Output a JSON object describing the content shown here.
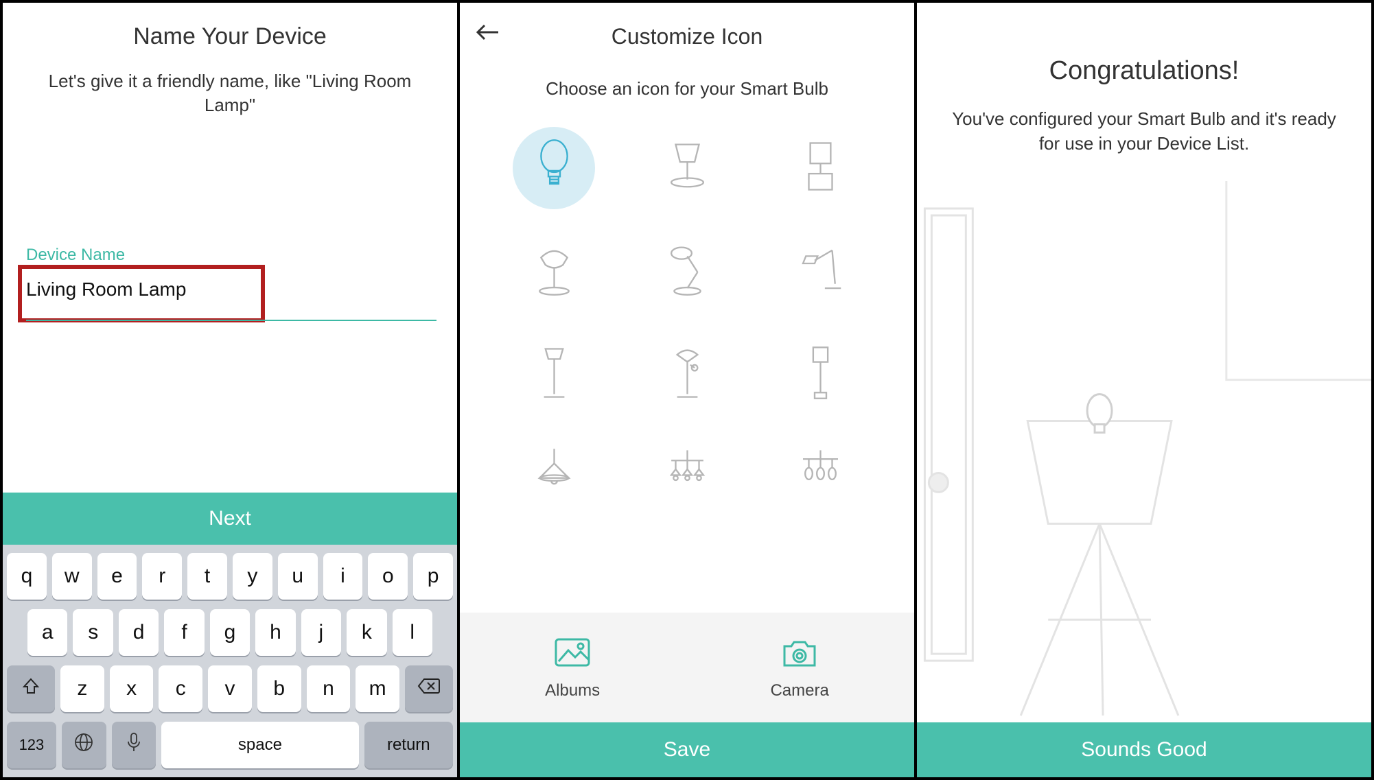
{
  "panel1": {
    "title": "Name Your Device",
    "subtitle": "Let's give it a friendly name, like \"Living Room Lamp\"",
    "field_label": "Device Name",
    "field_value": "Living Room Lamp",
    "next_label": "Next"
  },
  "keyboard": {
    "row1": [
      "q",
      "w",
      "e",
      "r",
      "t",
      "y",
      "u",
      "i",
      "o",
      "p"
    ],
    "row2": [
      "a",
      "s",
      "d",
      "f",
      "g",
      "h",
      "j",
      "k",
      "l"
    ],
    "row3": [
      "z",
      "x",
      "c",
      "v",
      "b",
      "n",
      "m"
    ],
    "num": "123",
    "space": "space",
    "return": "return"
  },
  "panel2": {
    "title": "Customize Icon",
    "subtitle": "Choose an icon for your Smart Bulb",
    "icons": [
      "bulb",
      "table-lamp",
      "bedside-lamp",
      "shaded-lamp",
      "desk-lamp",
      "arm-lamp",
      "floor-lamp",
      "torchiere",
      "pillar-lamp",
      "pendant",
      "triple-pendant",
      "track-light"
    ],
    "selected_icon": "bulb",
    "albums_label": "Albums",
    "camera_label": "Camera",
    "save_label": "Save"
  },
  "panel3": {
    "title": "Congratulations!",
    "subtitle": "You've configured your Smart Bulb and it's ready for use in your Device List.",
    "button_label": "Sounds Good"
  }
}
